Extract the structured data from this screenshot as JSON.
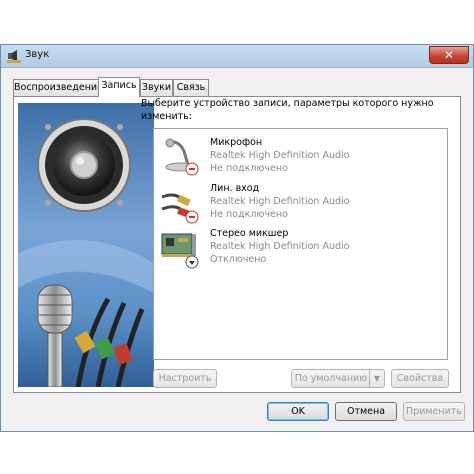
{
  "window": {
    "title": "Звук",
    "close_glyph": "✕"
  },
  "tabs": [
    {
      "label": "Воспроизведение"
    },
    {
      "label": "Запись"
    },
    {
      "label": "Звуки"
    },
    {
      "label": "Связь"
    }
  ],
  "instruction": "Выберите устройство записи, параметры которого нужно изменить:",
  "devices": [
    {
      "name": "Микрофон",
      "driver": "Realtek High Definition Audio",
      "status": "Не подключено",
      "icon": "microphone-icon"
    },
    {
      "name": "Лин. вход",
      "driver": "Realtek High Definition Audio",
      "status": "Не подключено",
      "icon": "line-in-cable-icon"
    },
    {
      "name": "Стерео микшер",
      "driver": "Realtek High Definition Audio",
      "status": "Отключено",
      "icon": "sound-card-icon"
    }
  ],
  "buttons": {
    "configure": "Настроить",
    "default": "По умолчанию",
    "properties": "Свойства",
    "ok": "OK",
    "cancel": "Отмена",
    "apply": "Применить"
  },
  "colors": {
    "title_bar": "#c9dcef",
    "close_button": "#c94634",
    "art_background": "#6b93c4",
    "speaker_dark": "#2b2b2b",
    "status_red": "#c0392b"
  }
}
